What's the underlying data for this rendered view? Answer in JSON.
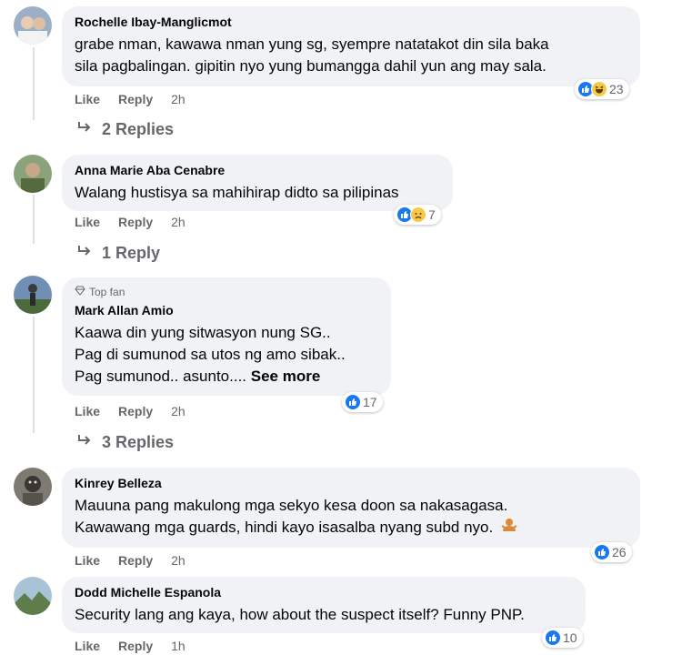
{
  "comments": [
    {
      "name": "Rochelle Ibay-Manglicmot",
      "lines": [
        "grabe nman, kawawa nman yung sg, syempre natatakot din sila baka",
        "sila pagbalingan. gipitin nyo yung bumangga dahil yun ang may sala."
      ],
      "reaction_count": "23",
      "reactions": [
        "like-icon",
        "haha-icon"
      ],
      "like": "Like",
      "reply": "Reply",
      "time": "2h",
      "replies": "2 Replies"
    },
    {
      "name": "Anna Marie Aba Cenabre",
      "lines": [
        "Walang hustisya sa mahihirap didto sa pilipinas"
      ],
      "reaction_count": "7",
      "reactions": [
        "like-icon",
        "sad-icon"
      ],
      "like": "Like",
      "reply": "Reply",
      "time": "2h",
      "replies": "1 Reply"
    },
    {
      "badge": "Top fan",
      "name": "Mark Allan Amio",
      "lines": [
        "Kaawa din yung sitwasyon nung SG..",
        "Pag di sumunod sa utos ng amo sibak..",
        "Pag sumunod.. asunto...."
      ],
      "see_more": "See more",
      "reaction_count": "17",
      "reactions": [
        "like-icon"
      ],
      "like": "Like",
      "reply": "Reply",
      "time": "2h",
      "replies": "3 Replies"
    },
    {
      "name": "Kinrey Belleza",
      "lines": [
        "Mauuna pang makulong mga sekyo kesa doon sa nakasagasa.",
        "Kawawang mga guards, hindi kayo isasalba nyang subd nyo."
      ],
      "emoji": "person-shrugging-emoji",
      "reaction_count": "26",
      "reactions": [
        "like-icon"
      ],
      "like": "Like",
      "reply": "Reply",
      "time": "2h"
    },
    {
      "name": "Dodd Michelle Espanola",
      "lines": [
        "Security lang ang kaya, how about the suspect itself? Funny PNP."
      ],
      "reaction_count": "10",
      "reactions": [
        "like-icon"
      ],
      "like": "Like",
      "reply": "Reply",
      "time": "1h"
    }
  ],
  "colors": {
    "bubble": "#f0f2f5",
    "like_blue": "#1877f2",
    "meta_gray": "#65676b",
    "emoji_yellow": "#f7c945"
  }
}
